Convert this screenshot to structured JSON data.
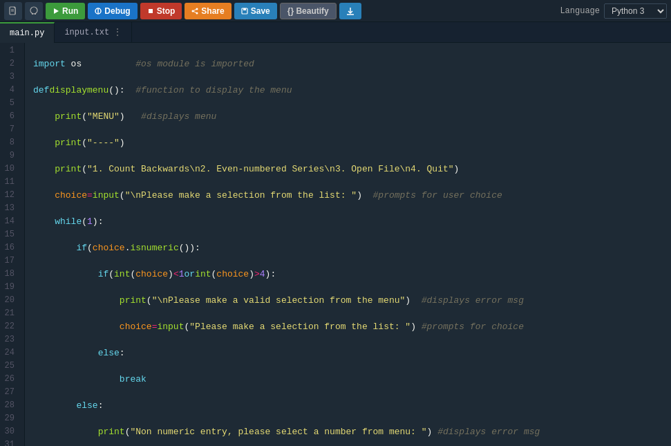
{
  "toolbar": {
    "run_label": "Run",
    "debug_label": "Debug",
    "stop_label": "Stop",
    "share_label": "Share",
    "save_label": "Save",
    "beautify_label": "{} Beautify",
    "language_label": "Language",
    "language_value": "Python 3"
  },
  "tabs": [
    {
      "id": "main",
      "label": "main.py",
      "active": true
    },
    {
      "id": "input",
      "label": "input.txt",
      "active": false
    }
  ],
  "lines": [
    1,
    2,
    3,
    4,
    5,
    6,
    7,
    8,
    9,
    10,
    11,
    12,
    13,
    14,
    15,
    16,
    17,
    18,
    19,
    20,
    21,
    22,
    23,
    24,
    25,
    26,
    27,
    28,
    29,
    30,
    31
  ]
}
